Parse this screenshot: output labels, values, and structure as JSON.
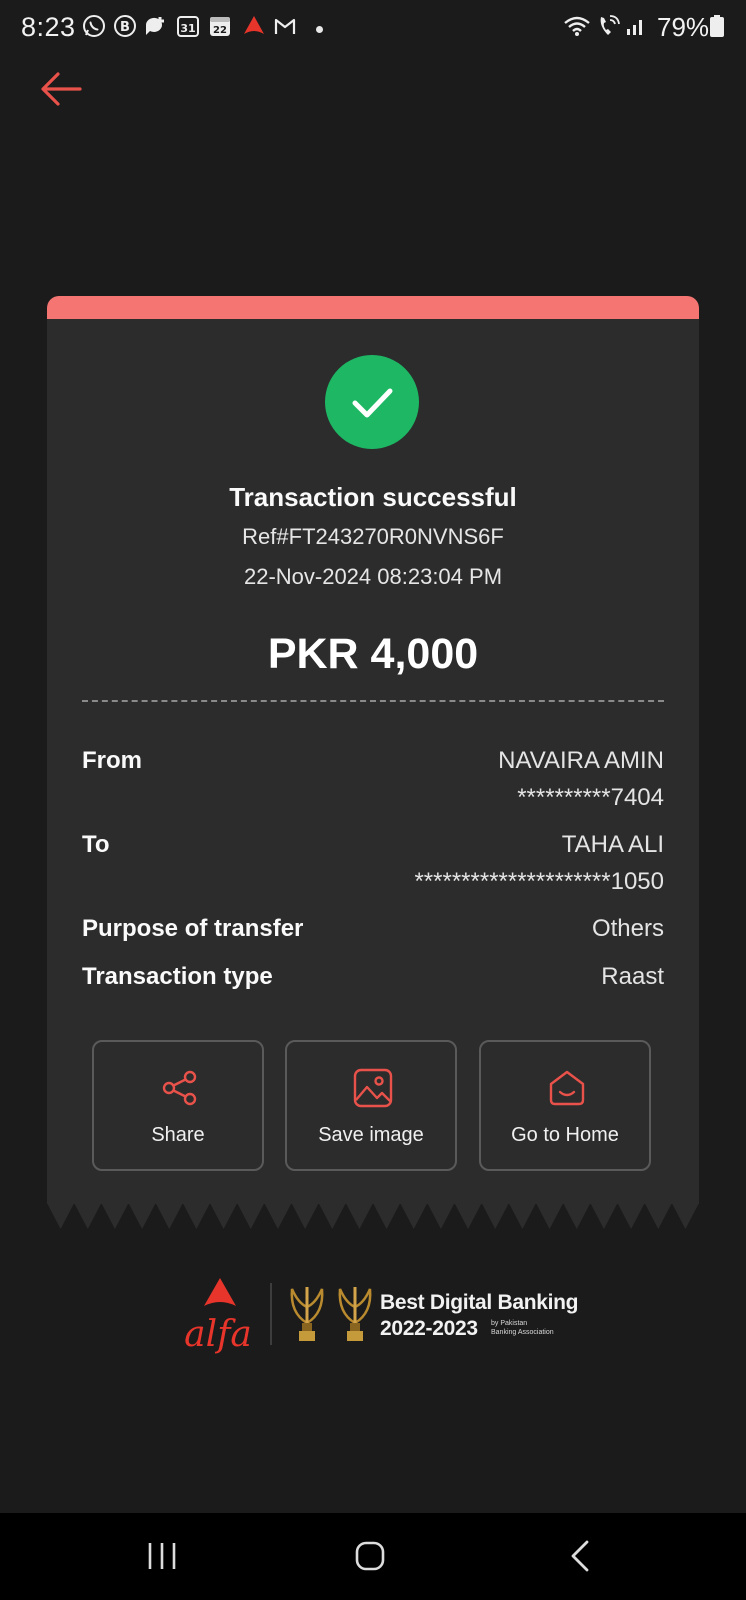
{
  "status_bar": {
    "time": "8:23",
    "notif_calendar_day": "31",
    "notif_date_day": "22",
    "battery": "79%"
  },
  "receipt": {
    "title": "Transaction successful",
    "reference": "Ref#FT243270R0NVNS6F",
    "datetime": "22-Nov-2024 08:23:04 PM",
    "amount": "PKR 4,000",
    "from_label": "From",
    "from_name": "NAVAIRA AMIN",
    "from_account": "**********7404",
    "to_label": "To",
    "to_name": "TAHA ALI",
    "to_account": "*********************1050",
    "purpose_label": "Purpose of transfer",
    "purpose_value": "Others",
    "type_label": "Transaction type",
    "type_value": "Raast"
  },
  "actions": {
    "share": "Share",
    "save_image": "Save image",
    "go_home": "Go to Home"
  },
  "footer": {
    "brand": "alfa",
    "award_title": "Best Digital Banking",
    "award_years": "2022-2023",
    "award_by_line1": "by Pakistan",
    "award_by_line2": "Banking Association"
  },
  "colors": {
    "accent_red": "#e8524a",
    "success_green": "#1eb865",
    "receipt_band": "#f47572"
  }
}
